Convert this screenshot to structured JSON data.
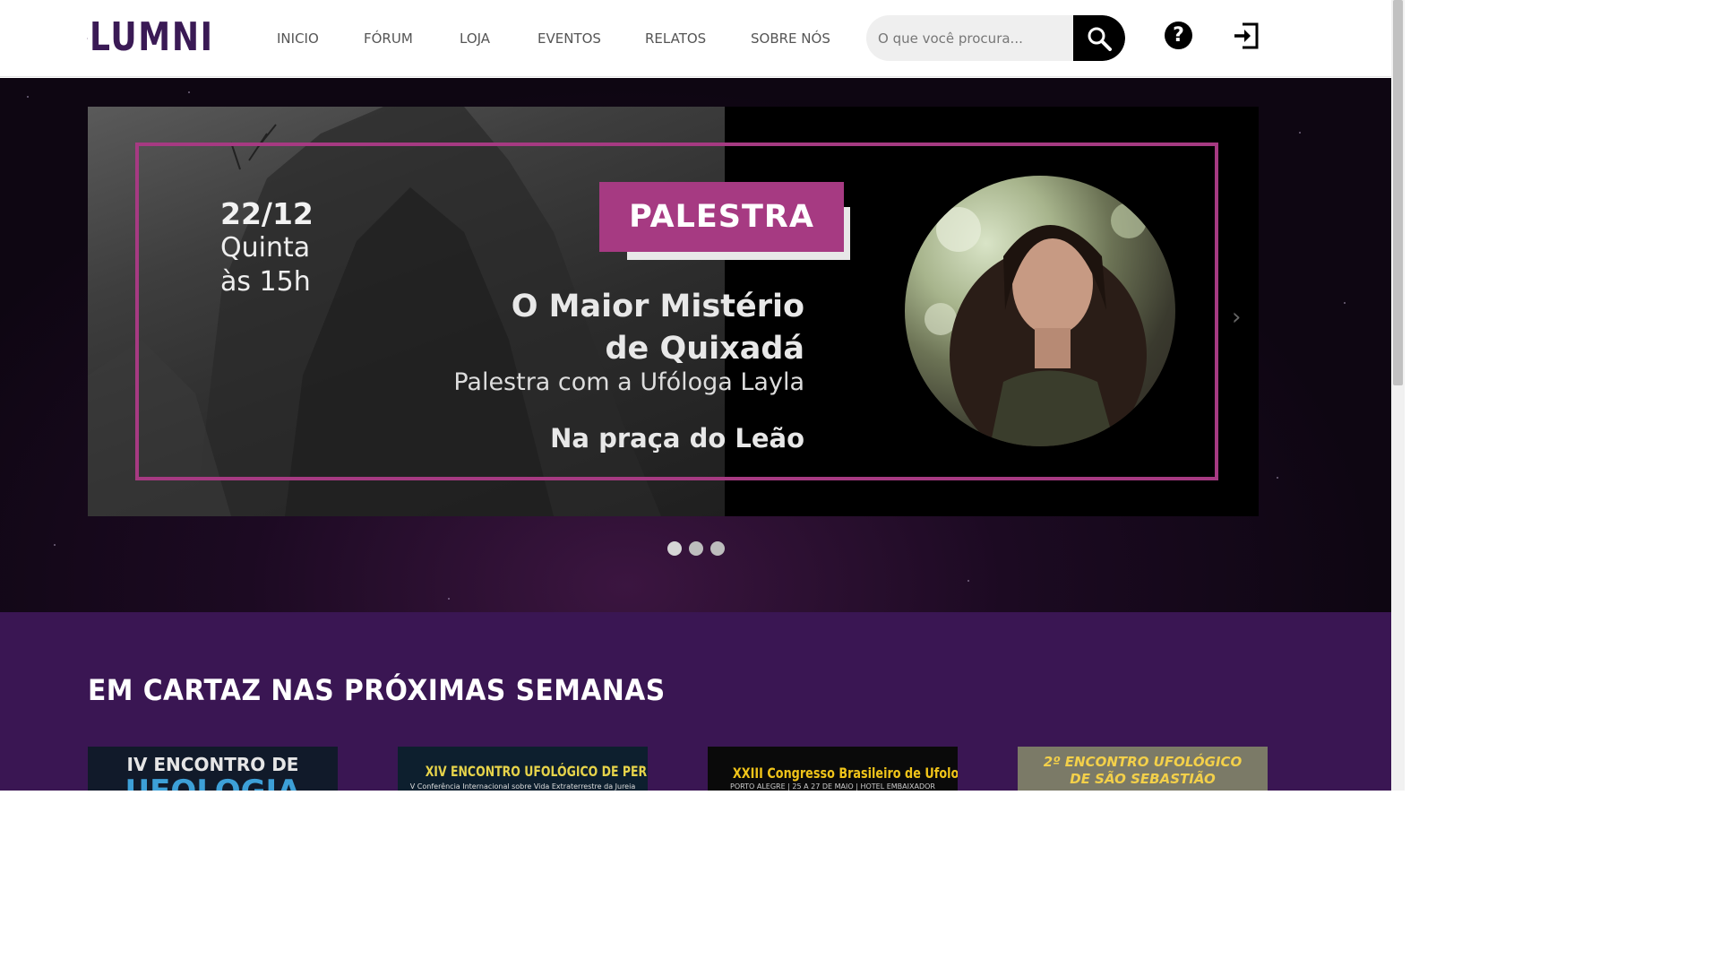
{
  "brand": {
    "name": "LUMNI"
  },
  "nav": {
    "items": [
      {
        "label": "INICIO"
      },
      {
        "label": "FÓRUM"
      },
      {
        "label": "LOJA"
      },
      {
        "label": "EVENTOS"
      },
      {
        "label": "RELATOS"
      },
      {
        "label": "SOBRE NÓS"
      }
    ]
  },
  "search": {
    "placeholder": "O que você procura..."
  },
  "icons": {
    "help": "question-circle-icon",
    "login": "sign-in-icon",
    "search": "search-icon"
  },
  "carousel": {
    "slide": {
      "date": "22/12",
      "weekday": "Quinta",
      "time": "às 15h",
      "tag": "PALESTRA",
      "title_line1": "O Maior Mistério",
      "title_line2": "de Quixadá",
      "subtitle": "Palestra com a Ufóloga Layla",
      "location": "Na praça do Leão"
    },
    "next_label": "›",
    "dot_count": 3,
    "active_dot": 0
  },
  "section": {
    "title": "EM CARTAZ NAS PRÓXIMAS SEMANAS",
    "cards": [
      {
        "title": "IV ENCONTRO DE",
        "subtitle": "UFOLOGIA"
      },
      {
        "title": "XIV ENCONTRO UFOLÓGICO DE PERUÍBE",
        "subtitle": "V Conferência Internacional sobre Vida Extraterrestre da Jureia"
      },
      {
        "title": "XXIII Congresso Brasileiro de Ufologia",
        "subtitle": "PORTO ALEGRE | 25 A 27 DE MAIO | HOTEL EMBAIXADOR"
      },
      {
        "title": "2º ENCONTRO UFOLÓGICO",
        "subtitle": "DE SÃO SEBASTIÃO"
      }
    ]
  },
  "colors": {
    "accent": "#a63a82",
    "section_bg": "#3a1653",
    "logo": "#3a1a55"
  }
}
